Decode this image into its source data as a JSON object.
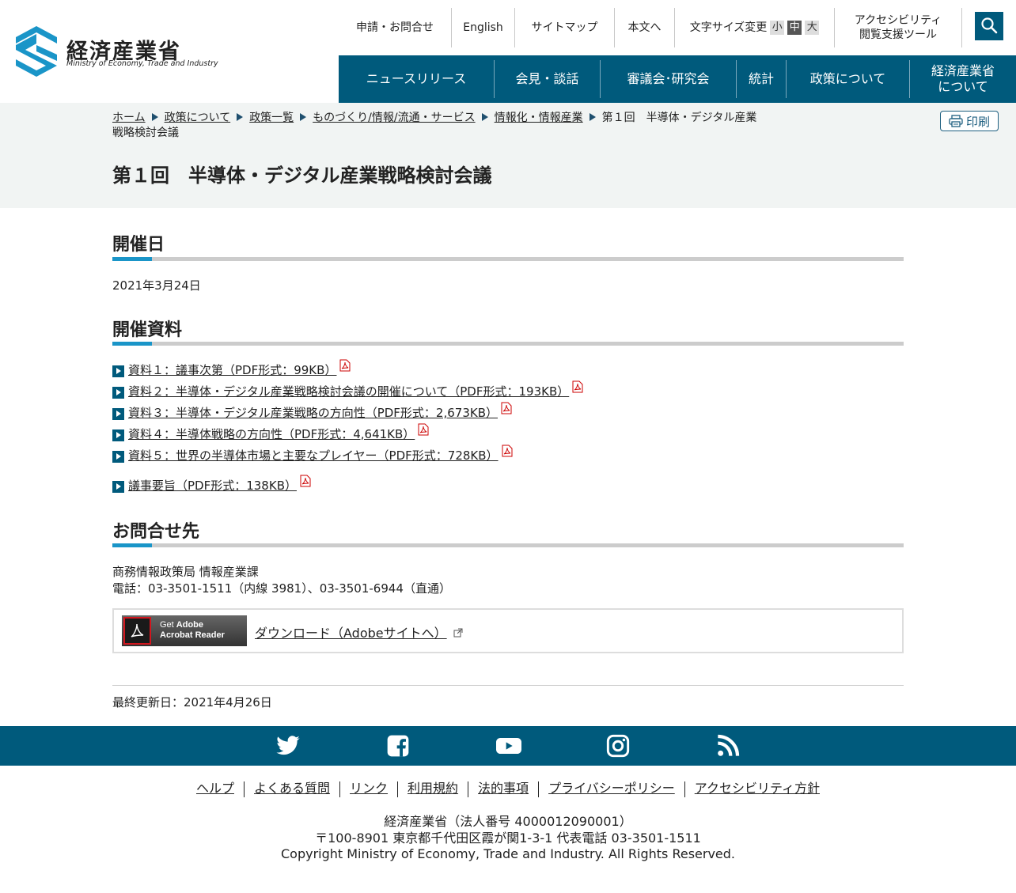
{
  "header": {
    "logo_ja": "経済産業省",
    "logo_en": "Ministry of Economy, Trade and Industry",
    "util": {
      "contact": "申請・お問合せ",
      "english": "English",
      "sitemap": "サイトマップ",
      "to_body": "本文へ",
      "font_size_label": "文字サイズ変更",
      "font_small": "小",
      "font_medium": "中",
      "font_large": "大",
      "accessibility_line1": "アクセシビリティ",
      "accessibility_line2": "閲覧支援ツール"
    },
    "gnav": {
      "news": "ニュースリリース",
      "press": "会見・談話",
      "council": "審議会･研究会",
      "stats": "統計",
      "policy": "政策について",
      "about_line1": "経済産業省",
      "about_line2": "について"
    },
    "colors": {
      "brand": "#005a7c",
      "accent": "#1a95c8"
    }
  },
  "breadcrumb": {
    "home": "ホーム",
    "policy": "政策について",
    "policy_list": "政策一覧",
    "monozukuri": "ものづくり/情報/流通・サービス",
    "info_industry": "情報化・情報産業",
    "current": "第１回　半導体・デジタル産業戦略検討会議"
  },
  "print_label": "印刷",
  "page_title": "第１回　半導体・デジタル産業戦略検討会議",
  "sections": {
    "date": {
      "heading": "開催日",
      "value": "2021年3月24日"
    },
    "materials": {
      "heading": "開催資料",
      "items": [
        "資料１：議事次第（PDF形式：99KB）",
        "資料２：半導体・デジタル産業戦略検討会議の開催について（PDF形式：193KB）",
        "資料３：半導体・デジタル産業戦略の方向性（PDF形式：2,673KB）",
        "資料４：半導体戦略の方向性（PDF形式：4,641KB）",
        "資料５：世界の半導体市場と主要なプレイヤー（PDF形式：728KB）"
      ],
      "summary": "議事要旨（PDF形式：138KB）"
    },
    "contact": {
      "heading": "お問合せ先",
      "dept": "商務情報政策局 情報産業課",
      "phone": "電話：03-3501-1511（内線 3981）、03-3501-6944（直通）"
    }
  },
  "adobe": {
    "badge_get": "Get",
    "badge_adobe": "Adobe",
    "badge_reader": "Acrobat Reader",
    "download_link": "ダウンロード（Adobeサイトへ）"
  },
  "last_updated": "最終更新日：2021年4月26日",
  "social": [
    "twitter-icon",
    "facebook-icon",
    "youtube-icon",
    "instagram-icon",
    "rss-icon"
  ],
  "footer": {
    "links": {
      "help": "ヘルプ",
      "faq": "よくある質問",
      "link": "リンク",
      "terms": "利用規約",
      "legal": "法的事項",
      "privacy": "プライバシーポリシー",
      "accessibility": "アクセシビリティ方針"
    },
    "org": "経済産業省（法人番号 4000012090001）",
    "address": "〒100-8901 東京都千代田区霞が関1-3-1 代表電話 03-3501-1511",
    "copyright": "Copyright Ministry of Economy, Trade and Industry. All Rights Reserved."
  }
}
